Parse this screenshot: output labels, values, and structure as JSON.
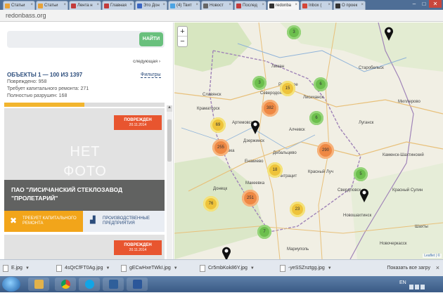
{
  "browser": {
    "tabs": [
      {
        "label": "Статьи",
        "color": "#e8a33a",
        "active": false
      },
      {
        "label": "Статьи",
        "color": "#e8a33a",
        "active": false
      },
      {
        "label": "Лента н",
        "color": "#c33b3b",
        "active": false
      },
      {
        "label": "Главная",
        "color": "#c33b3b",
        "active": false
      },
      {
        "label": "Это Дон",
        "color": "#3a66c3",
        "active": false
      },
      {
        "label": "(4) Твит",
        "color": "#4ba3e3",
        "active": false
      },
      {
        "label": "Новост",
        "color": "#666666",
        "active": false
      },
      {
        "label": "Послед",
        "color": "#c33b3b",
        "active": false
      },
      {
        "label": "redonba",
        "color": "#333333",
        "active": true
      },
      {
        "label": "Inbox (",
        "color": "#d44638",
        "active": false
      },
      {
        "label": "О проек",
        "color": "#333333",
        "active": false
      }
    ],
    "url": "redonbass.org"
  },
  "sidebar": {
    "search_button": "НАЙТИ",
    "next_link": "следующая ›",
    "objects_title": "ОБЪЕКТЫ 1 — 100 ИЗ 1397",
    "filters": "Фильтры",
    "stats": [
      "Повреждено: 958",
      "Требует капитального ремонта: 271",
      "Полностью разрушен: 168"
    ],
    "progress_fraction": 0.5,
    "card": {
      "badge_status": "ПОВРЕЖДЕН",
      "badge_date": "20.11.2014",
      "no_photo_line1": "НЕТ",
      "no_photo_line2": "ФОТО",
      "name": "ПАО \"ЛИСИЧАНСКИЙ СТЕКЛОЗАВОД \"ПРОЛЕТАРИЙ\"",
      "tag_repair": "ТРЕБУЕТ КАПИТАЛЬНОГО РЕМОНТА",
      "tag_category": "ПРОИЗВОДСТВЕННЫЕ ПРЕДПРИЯТИЯ"
    },
    "card2": {
      "badge_status": "ПОВРЕЖДЕН",
      "badge_date": "20.11.2014"
    }
  },
  "map": {
    "zoom_in": "+",
    "zoom_out": "−",
    "attribution": "Leaflet | ©",
    "clusters": [
      {
        "label": "3",
        "color": "green"
      },
      {
        "label": "3",
        "color": "green"
      },
      {
        "label": "15",
        "color": "yellow"
      },
      {
        "label": "6",
        "color": "green"
      },
      {
        "label": "382",
        "color": "orange"
      },
      {
        "label": "6",
        "color": "green"
      },
      {
        "label": "69",
        "color": "yellow"
      },
      {
        "label": "255",
        "color": "orange"
      },
      {
        "label": "290",
        "color": "orange"
      },
      {
        "label": "18",
        "color": "yellow"
      },
      {
        "label": "5",
        "color": "green"
      },
      {
        "label": "251",
        "color": "orange"
      },
      {
        "label": "76",
        "color": "yellow"
      },
      {
        "label": "23",
        "color": "yellow"
      },
      {
        "label": "7",
        "color": "green"
      }
    ],
    "cities": [
      "Старобельск",
      "Лиман",
      "Рубежное",
      "Северодонецк",
      "Славянск",
      "Лисичанск",
      "Краматорск",
      "Луганск",
      "Артемовск",
      "Алчевск",
      "Дзержинск",
      "Горловка",
      "Енакиево",
      "Донецк",
      "Макеевка",
      "Антрацит",
      "Свердловск",
      "Красный Луч",
      "Мариуполь",
      "Миллерово",
      "Каменск-Шахтинский",
      "Новошахтинск",
      "Красный Сулин",
      "Дебальцево",
      "Шахты",
      "Новочеркасск"
    ]
  },
  "downloads": {
    "items": [
      "E.jpg",
      "4sQrCfFT0Ag.jpg",
      "gECwHxeTWkI.jpg",
      "Cr5mbKok86Y.jpg",
      "-yeSSZnztgg.jpg"
    ],
    "show_all": "Показать все загру",
    "close": "×"
  },
  "taskbar": {
    "lang": "EN"
  }
}
